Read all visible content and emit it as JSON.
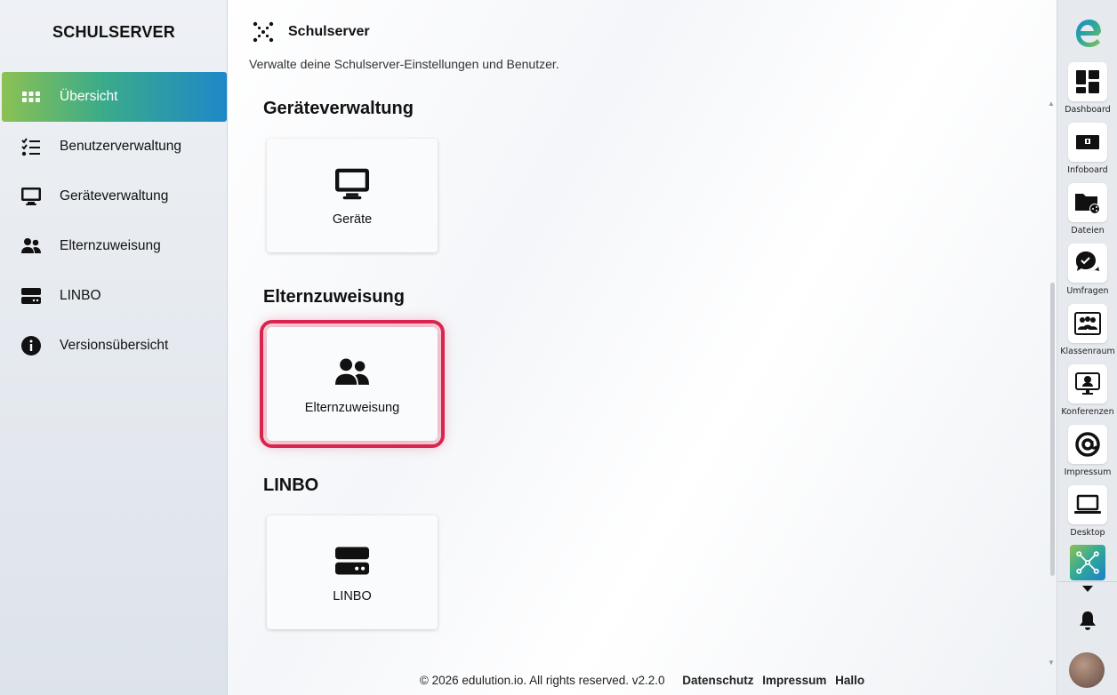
{
  "sidebar": {
    "title": "SCHULSERVER",
    "items": [
      {
        "label": "Übersicht",
        "icon": "grid-icon",
        "active": true
      },
      {
        "label": "Benutzerverwaltung",
        "icon": "checklist-icon"
      },
      {
        "label": "Geräteverwaltung",
        "icon": "monitor-icon"
      },
      {
        "label": "Elternzuweisung",
        "icon": "users-icon"
      },
      {
        "label": "LINBO",
        "icon": "server-icon"
      },
      {
        "label": "Versionsübersicht",
        "icon": "info-icon"
      }
    ]
  },
  "header": {
    "title": "Schulserver",
    "subtitle": "Verwalte deine Schulserver-Einstellungen und Benutzer."
  },
  "sections": [
    {
      "title": "Geräteverwaltung",
      "card_label": "Geräte",
      "icon": "monitor-icon"
    },
    {
      "title": "Elternzuweisung",
      "card_label": "Elternzuweisung",
      "icon": "users-icon",
      "highlighted": true
    },
    {
      "title": "LINBO",
      "card_label": "LINBO",
      "icon": "server-icon"
    }
  ],
  "footer": {
    "copyright": "© 2026 edulution.io. All rights reserved. v2.2.0",
    "links": [
      "Datenschutz",
      "Impressum",
      "Hallo"
    ]
  },
  "dock": {
    "items": [
      {
        "label": "Dashboard",
        "icon": "dashboard-icon"
      },
      {
        "label": "Infoboard",
        "icon": "infoboard-icon"
      },
      {
        "label": "Dateien",
        "icon": "folder-share-icon"
      },
      {
        "label": "Umfragen",
        "icon": "survey-icon"
      },
      {
        "label": "Klassenraum",
        "icon": "classroom-icon"
      },
      {
        "label": "Konferenzen",
        "icon": "conference-icon"
      },
      {
        "label": "Impressum",
        "icon": "at-icon"
      },
      {
        "label": "Desktop",
        "icon": "laptop-icon"
      }
    ]
  },
  "colors": {
    "accent_start": "#8cc152",
    "accent_end": "#1e88c8",
    "highlight": "#d9254d"
  }
}
